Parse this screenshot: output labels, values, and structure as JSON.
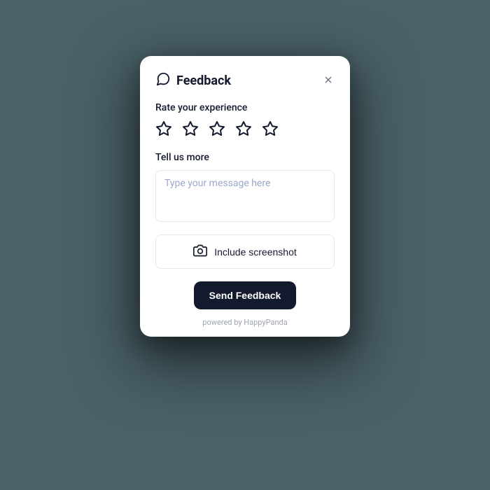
{
  "header": {
    "title": "Feedback"
  },
  "rating": {
    "label": "Rate your experience"
  },
  "message": {
    "label": "Tell us more",
    "placeholder": "Type your message here"
  },
  "screenshot": {
    "label": "Include screenshot"
  },
  "submit": {
    "label": "Send Feedback"
  },
  "footer": {
    "powered": "powered by HappyPanda"
  }
}
